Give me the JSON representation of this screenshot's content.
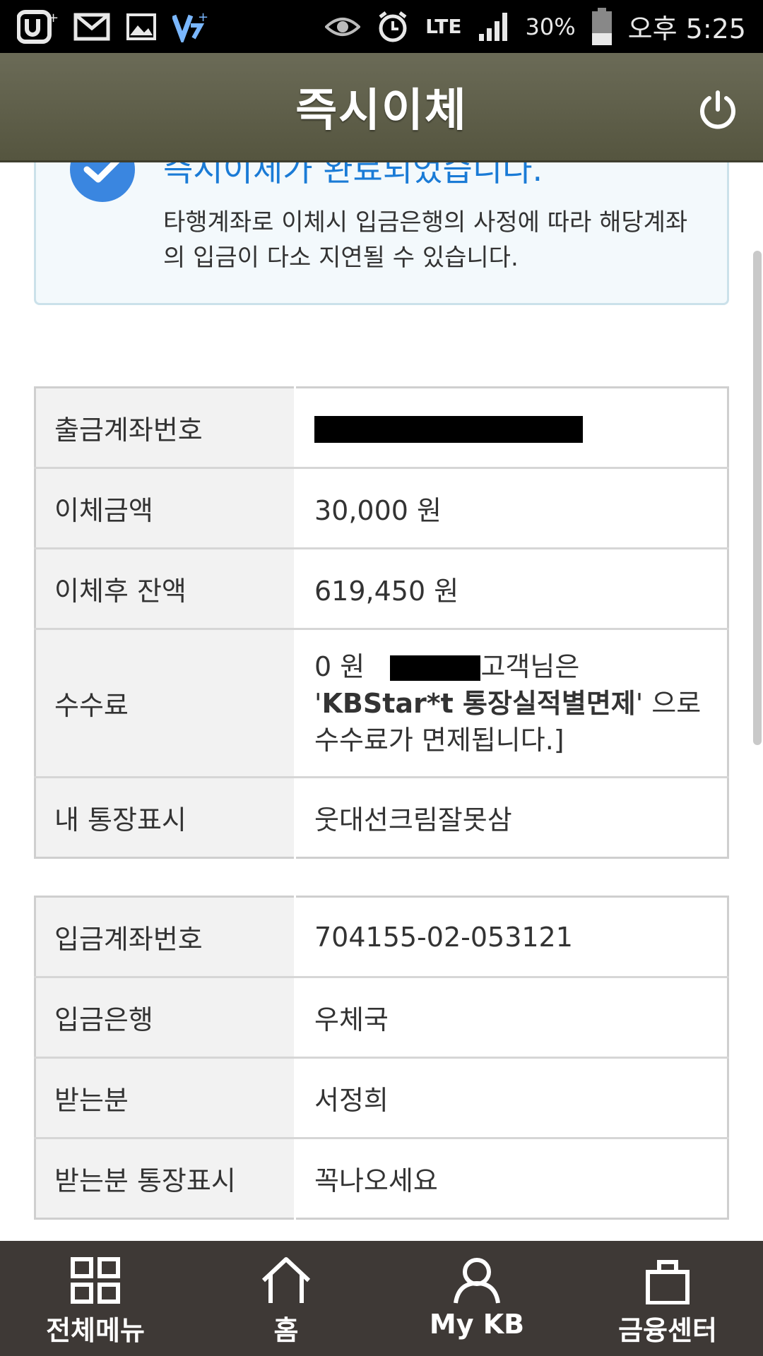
{
  "status_bar": {
    "battery": "30%",
    "network": "LTE",
    "time": "오후 5:25"
  },
  "header": {
    "title": "즉시이체"
  },
  "notice": {
    "title": "즉시이체가 완료되었습니다.",
    "description": "타행계좌로 이체시 입금은행의 사정에 따라 해당계좌의 입금이 다소 지연될 수 있습니다."
  },
  "withdraw_table": {
    "rows": [
      {
        "label": "출금계좌번호",
        "value": ""
      },
      {
        "label": "이체금액",
        "value": "30,000 원"
      },
      {
        "label": "이체후 잔액",
        "value": "619,450 원"
      },
      {
        "label": "수수료",
        "value": ""
      },
      {
        "label": "내 통장표시",
        "value": "웃대선크림잘못삼"
      }
    ],
    "fee": {
      "amount": "0 원",
      "text_before": "고객님은 '",
      "bold_text": "KBStar*t 통장실적별면제",
      "text_after": "' 으로 수수료가 면제됩니다.]"
    }
  },
  "deposit_table": {
    "rows": [
      {
        "label": "입금계좌번호",
        "value": "704155-02-053121"
      },
      {
        "label": "입금은행",
        "value": "우체국"
      },
      {
        "label": "받는분",
        "value": "서정희"
      },
      {
        "label": "받는분 통장표시",
        "value": "꼭나오세요"
      }
    ]
  },
  "bottom_nav": {
    "items": [
      {
        "label": "전체메뉴",
        "icon": "grid-icon"
      },
      {
        "label": "홈",
        "icon": "home-icon"
      },
      {
        "label": "My KB",
        "icon": "person-icon"
      },
      {
        "label": "금융센터",
        "icon": "bag-icon"
      }
    ]
  },
  "colors": {
    "title_bar": "#5f5f4a",
    "notice_title": "#1a7bd6",
    "nav_bg": "#3e3936"
  }
}
